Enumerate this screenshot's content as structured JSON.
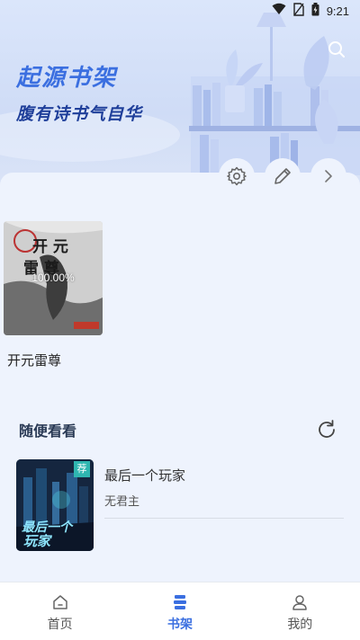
{
  "status_bar": {
    "time": "9:21",
    "icons": [
      "wifi-icon",
      "no-sim-icon",
      "battery-icon"
    ]
  },
  "header": {
    "title": "起源书架",
    "subtitle": "腹有诗书气自华",
    "search_icon": "search-icon"
  },
  "toolbar": {
    "icons": [
      "settings-icon",
      "edit-icon",
      "chevron-right-icon"
    ]
  },
  "shelf": {
    "books": [
      {
        "title": "开元雷尊",
        "progress_text": "100.00%",
        "cover_title": "开元雷尊"
      }
    ]
  },
  "recommend": {
    "title": "随便看看",
    "refresh_icon": "refresh-icon",
    "items": [
      {
        "title": "最后一个玩家",
        "author": "无君主",
        "badge": "荐",
        "cover_title": "最后一个玩家"
      }
    ]
  },
  "bottom_nav": {
    "items": [
      {
        "label": "首页",
        "icon": "home-icon",
        "active": false
      },
      {
        "label": "书架",
        "icon": "bookshelf-icon",
        "active": true
      },
      {
        "label": "我的",
        "icon": "profile-icon",
        "active": false
      }
    ]
  },
  "colors": {
    "accent": "#3b6fe0",
    "title_dark": "#1f3f9a",
    "background": "#eef3fd"
  }
}
